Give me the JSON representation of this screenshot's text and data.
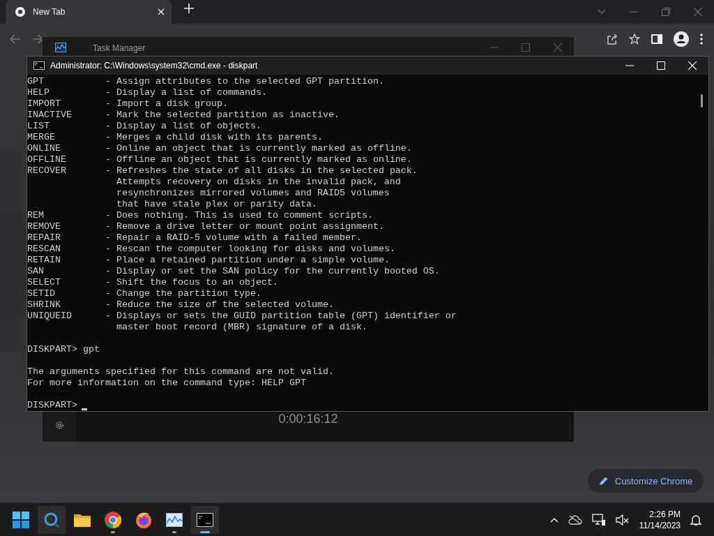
{
  "browser": {
    "tabs": [
      {
        "title": "New Tab",
        "selected": true
      }
    ],
    "customize_button": "Customize Chrome"
  },
  "task_manager": {
    "title": "Task Manager",
    "timer": "0:00:16:12"
  },
  "terminal": {
    "title": "Administrator: C:\\Windows\\system32\\cmd.exe - diskpart",
    "help": [
      {
        "command": "GPT",
        "lines": [
          "- Assign attributes to the selected GPT partition."
        ]
      },
      {
        "command": "HELP",
        "lines": [
          "- Display a list of commands."
        ]
      },
      {
        "command": "IMPORT",
        "lines": [
          "- Import a disk group."
        ]
      },
      {
        "command": "INACTIVE",
        "lines": [
          "- Mark the selected partition as inactive."
        ]
      },
      {
        "command": "LIST",
        "lines": [
          "- Display a list of objects."
        ]
      },
      {
        "command": "MERGE",
        "lines": [
          "- Merges a child disk with its parents."
        ]
      },
      {
        "command": "ONLINE",
        "lines": [
          "- Online an object that is currently marked as offline."
        ]
      },
      {
        "command": "OFFLINE",
        "lines": [
          "- Offline an object that is currently marked as online."
        ]
      },
      {
        "command": "RECOVER",
        "lines": [
          "- Refreshes the state of all disks in the selected pack.",
          "Attempts recovery on disks in the invalid pack, and",
          "resynchronizes mirrored volumes and RAID5 volumes",
          "that have stale plex or parity data."
        ]
      },
      {
        "command": "REM",
        "lines": [
          "- Does nothing. This is used to comment scripts."
        ]
      },
      {
        "command": "REMOVE",
        "lines": [
          "- Remove a drive letter or mount point assignment."
        ]
      },
      {
        "command": "REPAIR",
        "lines": [
          "- Repair a RAID-5 volume with a failed member."
        ]
      },
      {
        "command": "RESCAN",
        "lines": [
          "- Rescan the computer looking for disks and volumes."
        ]
      },
      {
        "command": "RETAIN",
        "lines": [
          "- Place a retained partition under a simple volume."
        ]
      },
      {
        "command": "SAN",
        "lines": [
          "- Display or set the SAN policy for the currently booted OS."
        ]
      },
      {
        "command": "SELECT",
        "lines": [
          "- Shift the focus to an object."
        ]
      },
      {
        "command": "SETID",
        "lines": [
          "- Change the partition type."
        ]
      },
      {
        "command": "SHRINK",
        "lines": [
          "- Reduce the size of the selected volume."
        ]
      },
      {
        "command": "UNIQUEID",
        "lines": [
          "- Displays or sets the GUID partition table (GPT) identifier or",
          "master boot record (MBR) signature of a disk."
        ]
      }
    ],
    "transcript": [
      {
        "kind": "blank"
      },
      {
        "kind": "prompt",
        "prompt": "DISKPART>",
        "input": "gpt",
        "cursor": false
      },
      {
        "kind": "blank"
      },
      {
        "kind": "output",
        "text": "The arguments specified for this command are not valid."
      },
      {
        "kind": "output",
        "text": "For more information on the command type: HELP GPT"
      },
      {
        "kind": "blank"
      },
      {
        "kind": "prompt",
        "prompt": "DISKPART>",
        "cursor": true
      }
    ]
  },
  "taskbar": {
    "apps": [
      {
        "kind": "start",
        "running": false,
        "active": false
      },
      {
        "kind": "search",
        "running": false,
        "active": true
      },
      {
        "kind": "folder",
        "running": false,
        "active": false
      },
      {
        "kind": "chrome",
        "running": true,
        "active": false
      },
      {
        "kind": "firefox",
        "running": false,
        "active": false
      },
      {
        "kind": "monitor",
        "running": true,
        "active": false
      },
      {
        "kind": "terminal",
        "running": true,
        "active": true
      }
    ],
    "time": "2:26 PM",
    "date": "11/14/2023"
  }
}
